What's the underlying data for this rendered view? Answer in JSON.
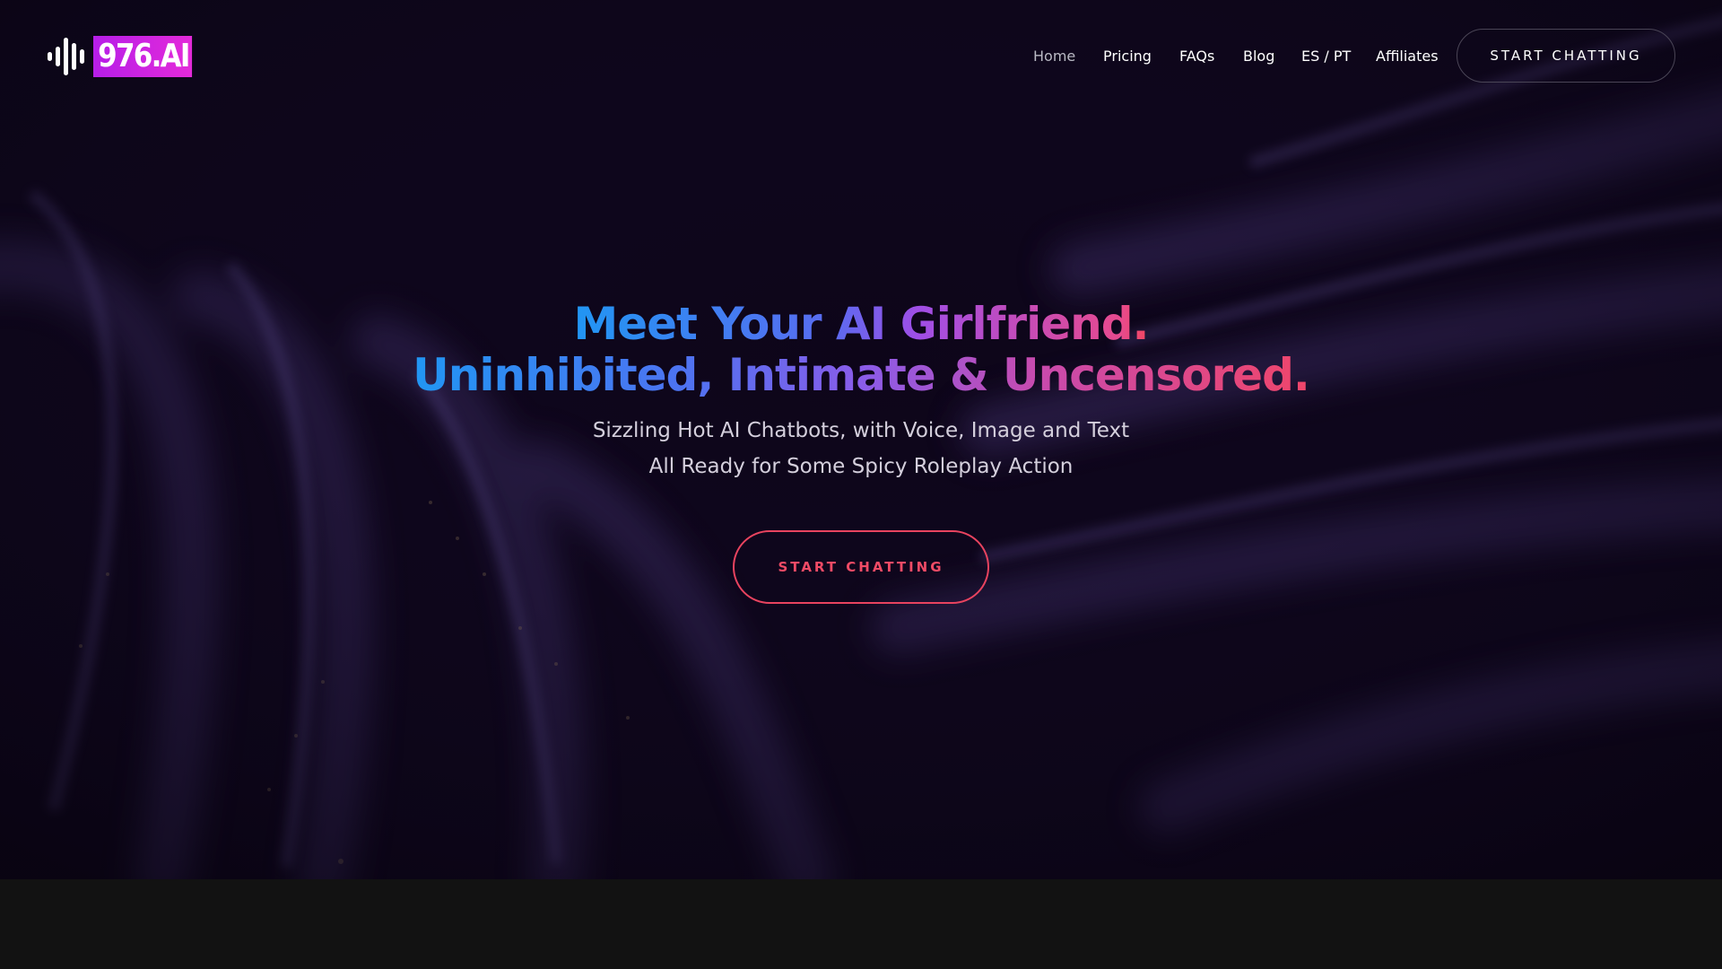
{
  "brand": {
    "logo_text": "976.AI",
    "logo_icon": "sound-wave-icon",
    "logo_color": "#d524e2"
  },
  "nav": {
    "items": [
      {
        "label": "Home",
        "active": true
      },
      {
        "label": "Pricing",
        "active": false
      },
      {
        "label": "FAQs",
        "active": false
      },
      {
        "label": "Blog",
        "active": false
      },
      {
        "label": "ES / PT",
        "active": false
      },
      {
        "label": "Affiliates",
        "active": false
      }
    ],
    "cta_label": "START CHATTING"
  },
  "hero": {
    "headline_line1": "Meet Your AI Girlfriend.",
    "headline_line2": "Uninhibited, Intimate & Uncensored.",
    "subheadline_line1": "Sizzling Hot AI Chatbots, with Voice, Image and Text",
    "subheadline_line2": "All Ready for Some Spicy Roleplay Action",
    "cta_label": "START CHATTING",
    "background": "particle-waves"
  },
  "colors": {
    "page_bg": "#0d0519",
    "footer_bg": "#121212",
    "gradient_start": "#2196f3",
    "gradient_mid": "#a04ee6",
    "gradient_end": "#f2465f",
    "cta_accent": "#e8435f"
  }
}
